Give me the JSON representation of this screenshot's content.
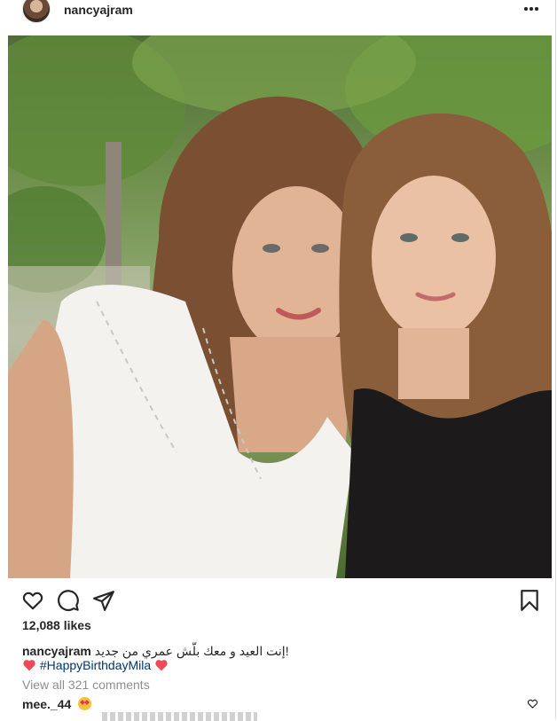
{
  "post": {
    "username": "nancyajram",
    "more_icon": "more-horizontal-icon",
    "photo_alt": "",
    "actions": {
      "like_icon": "heart-outline-icon",
      "comment_icon": "comment-icon",
      "share_icon": "paper-plane-icon",
      "save_icon": "bookmark-icon"
    },
    "likes": "12,088 likes",
    "caption": {
      "username": "nancyajram",
      "text": "!إنت العيد و معك بلّش عمري من جديد",
      "hashtag": "#HappyBirthdayMila"
    },
    "view_all_comments": "View all 321 comments",
    "comments": [
      {
        "username": "mee._44",
        "text": ""
      }
    ]
  },
  "colors": {
    "text": "#262626",
    "muted": "#8e8e8e",
    "link": "#00376b",
    "heart": "#ed4956",
    "border": "#dbdbdb"
  }
}
